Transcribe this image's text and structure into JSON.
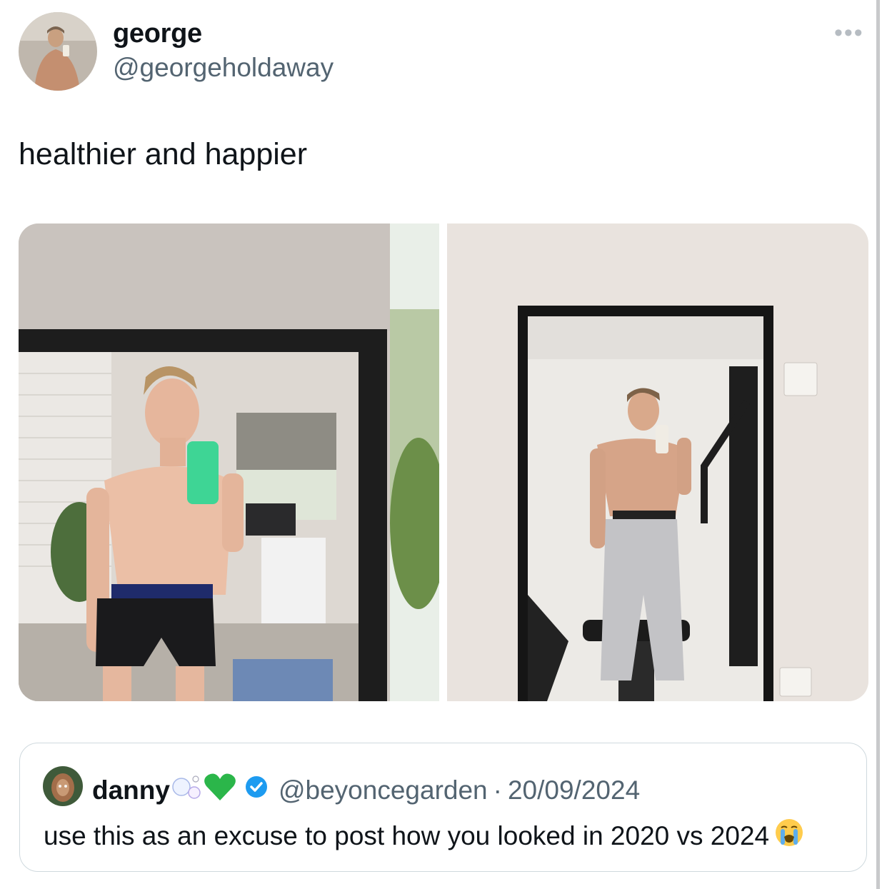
{
  "tweet": {
    "author_name": "george",
    "author_handle": "@georgeholdaway",
    "text": "healthier and happier",
    "more_icon": "more-horizontal-icon"
  },
  "media": {
    "left_photo": "mirror selfie 2020",
    "right_photo": "mirror selfie 2024"
  },
  "quoted_tweet": {
    "author_name": "danny",
    "name_emojis": [
      "bubbles-emoji",
      "green-heart-emoji"
    ],
    "verified_icon": "verified-badge-icon",
    "author_handle": "@beyoncegarden",
    "separator": "·",
    "date": "20/09/2024",
    "text": "use this as an excuse to post how you looked in 2020 vs 2024",
    "text_emoji": "loudly-crying-face-emoji"
  },
  "colors": {
    "text": "#0f1419",
    "secondary": "#536471",
    "border": "#cfd9de",
    "verified": "#1d9bf0",
    "green_heart": "#2bb64a"
  }
}
